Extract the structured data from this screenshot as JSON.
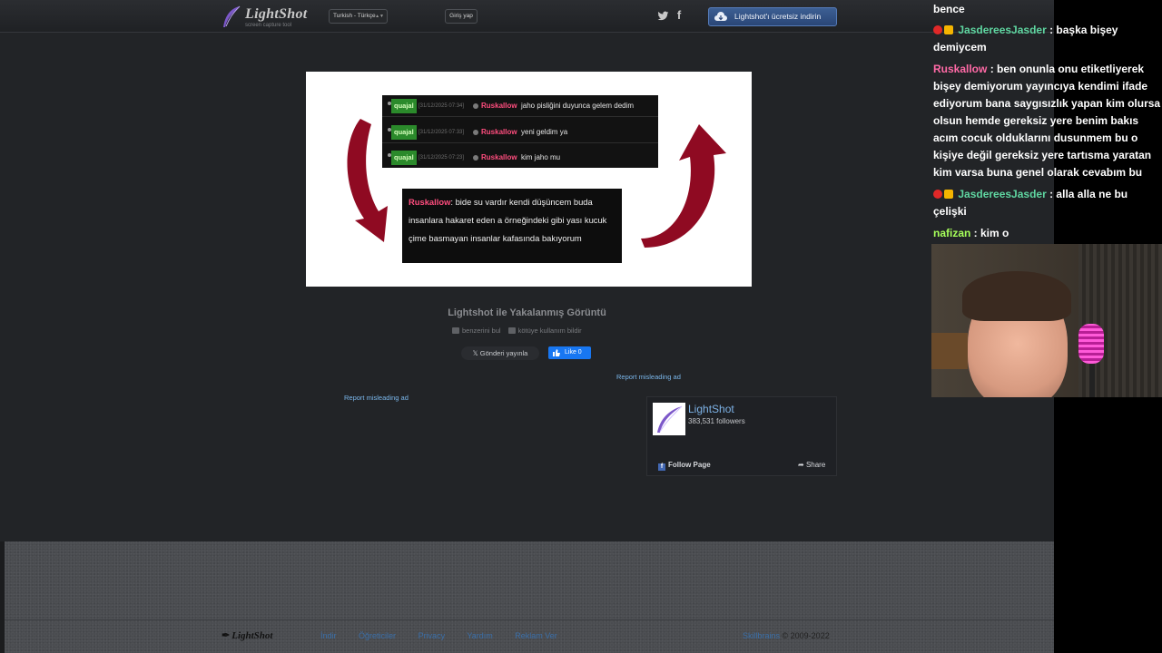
{
  "header": {
    "logo_text": "LightShot",
    "logo_sub": "screen capture tool",
    "language": "Turkish - Türkçe",
    "login": "Giriş yap",
    "download": "Lightshot'ı ücretsiz indirin"
  },
  "preview": {
    "rows": [
      {
        "user1": "quajal",
        "ts": "[31/12/2025 07:34]",
        "user2": "Ruskallow",
        "msg": "jaho pisliğini duyunca gelem dedim"
      },
      {
        "user1": "quajal",
        "ts": "[31/12/2025 07:33]",
        "user2": "Ruskallow",
        "msg": "yeni geldim ya"
      },
      {
        "user1": "quajal",
        "ts": "[31/12/2025 07:23]",
        "user2": "Ruskallow",
        "msg": "kim jaho mu"
      }
    ],
    "quote_name": "Ruskallow",
    "quote_text": ": bide su vardır kendi düşüncem buda insanlara hakaret eden a örneğindeki gibi yası kucuk çime basmayan insanlar kafasında bakıyorum"
  },
  "caption": {
    "title": "Lightshot ile Yakalanmış Görüntü",
    "find_similar": "benzerini bul",
    "report_abuse": "kötüye kullanım bildir",
    "tweet": "Gönderi yayınla",
    "like": "Like 0",
    "report_ad": "Report misleading ad"
  },
  "fb_widget": {
    "name": "LightShot",
    "followers": "383,531 followers",
    "follow": "Follow Page",
    "share": "Share"
  },
  "footer": {
    "logo": "LightShot",
    "nav": [
      "İndir",
      "Öğreticiler",
      "Privacy",
      "Yardım",
      "Reklam Ver"
    ],
    "company": "Skillbrains",
    "copyright": "© 2009-2022"
  },
  "chat": {
    "line0": "bence",
    "line1_name": "JasdereesJasder",
    "line1_text": " : başka bişey demiycem",
    "line2_name": "Ruskallow",
    "line2_text": " : ben onunla onu etiketliyerek bişey demiyorum yayıncıya kendimi ifade ediyorum bana saygısızlık yapan kim olursa olsun hemde gereksiz yere benim bakıs acım cocuk olduklarını dusunmem bu o kişiye değil gereksiz yere tartısma yaratan kim varsa buna genel olarak cevabım bu",
    "line3_name": "JasdereesJasder",
    "line3_text": " : alla alla ne bu çelişki",
    "line4_name": "nafizan",
    "line4_text": " : kim o"
  },
  "colors": {
    "page_bg": "#222427",
    "accent_blue": "#3d5f93",
    "chat_green": "#5fd6a1",
    "chat_pink": "#ff6aa6",
    "chat_lime": "#a6ff5a"
  }
}
